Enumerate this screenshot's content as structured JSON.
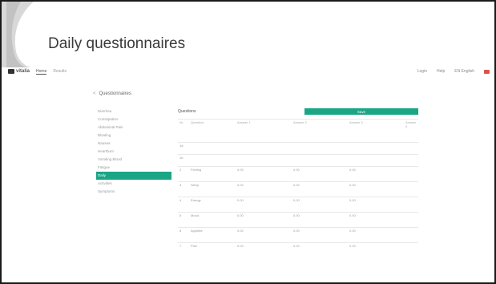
{
  "slide": {
    "title": "Daily questionnaires"
  },
  "topbar": {
    "logo": "vitalia",
    "nav": [
      "Home",
      "Results"
    ],
    "right": [
      "Login",
      "Help",
      "EN English"
    ]
  },
  "page": {
    "back": "<",
    "title": "Questionnaires"
  },
  "sidebar": {
    "items": [
      "Diarrhea",
      "Constipation",
      "Abdominal Pain",
      "Bloating",
      "Nausea",
      "Heartburn",
      "Vomiting Blood",
      "Fatigue",
      "Daily",
      "Activities",
      "Symptoms"
    ],
    "active_index": 8
  },
  "main": {
    "panel_title": "Questions",
    "save_label": "Save",
    "columns": [
      "Nr",
      "Question",
      "Answer 1",
      "Answer 2",
      "Answer 3",
      "Answer 4"
    ],
    "rows": [
      [
        "1a",
        "",
        "",
        "",
        "",
        ""
      ],
      [
        "1b",
        "",
        "",
        "",
        "",
        ""
      ],
      [
        "2",
        "Feeling",
        "0.00",
        "0.00",
        "0.00",
        ""
      ],
      [
        "3",
        "Sleep",
        "0.00",
        "0.00",
        "0.00",
        ""
      ],
      [
        "4",
        "Energy",
        "0.00",
        "0.00",
        "0.00",
        ""
      ],
      [
        "5",
        "Mood",
        "0.00",
        "0.00",
        "0.00",
        ""
      ],
      [
        "6",
        "Appetite",
        "0.00",
        "0.00",
        "0.00",
        ""
      ],
      [
        "7",
        "Pain",
        "0.00",
        "0.00",
        "0.00",
        ""
      ]
    ]
  },
  "colors": {
    "accent": "#1aa585",
    "flag": "#d9534f"
  }
}
